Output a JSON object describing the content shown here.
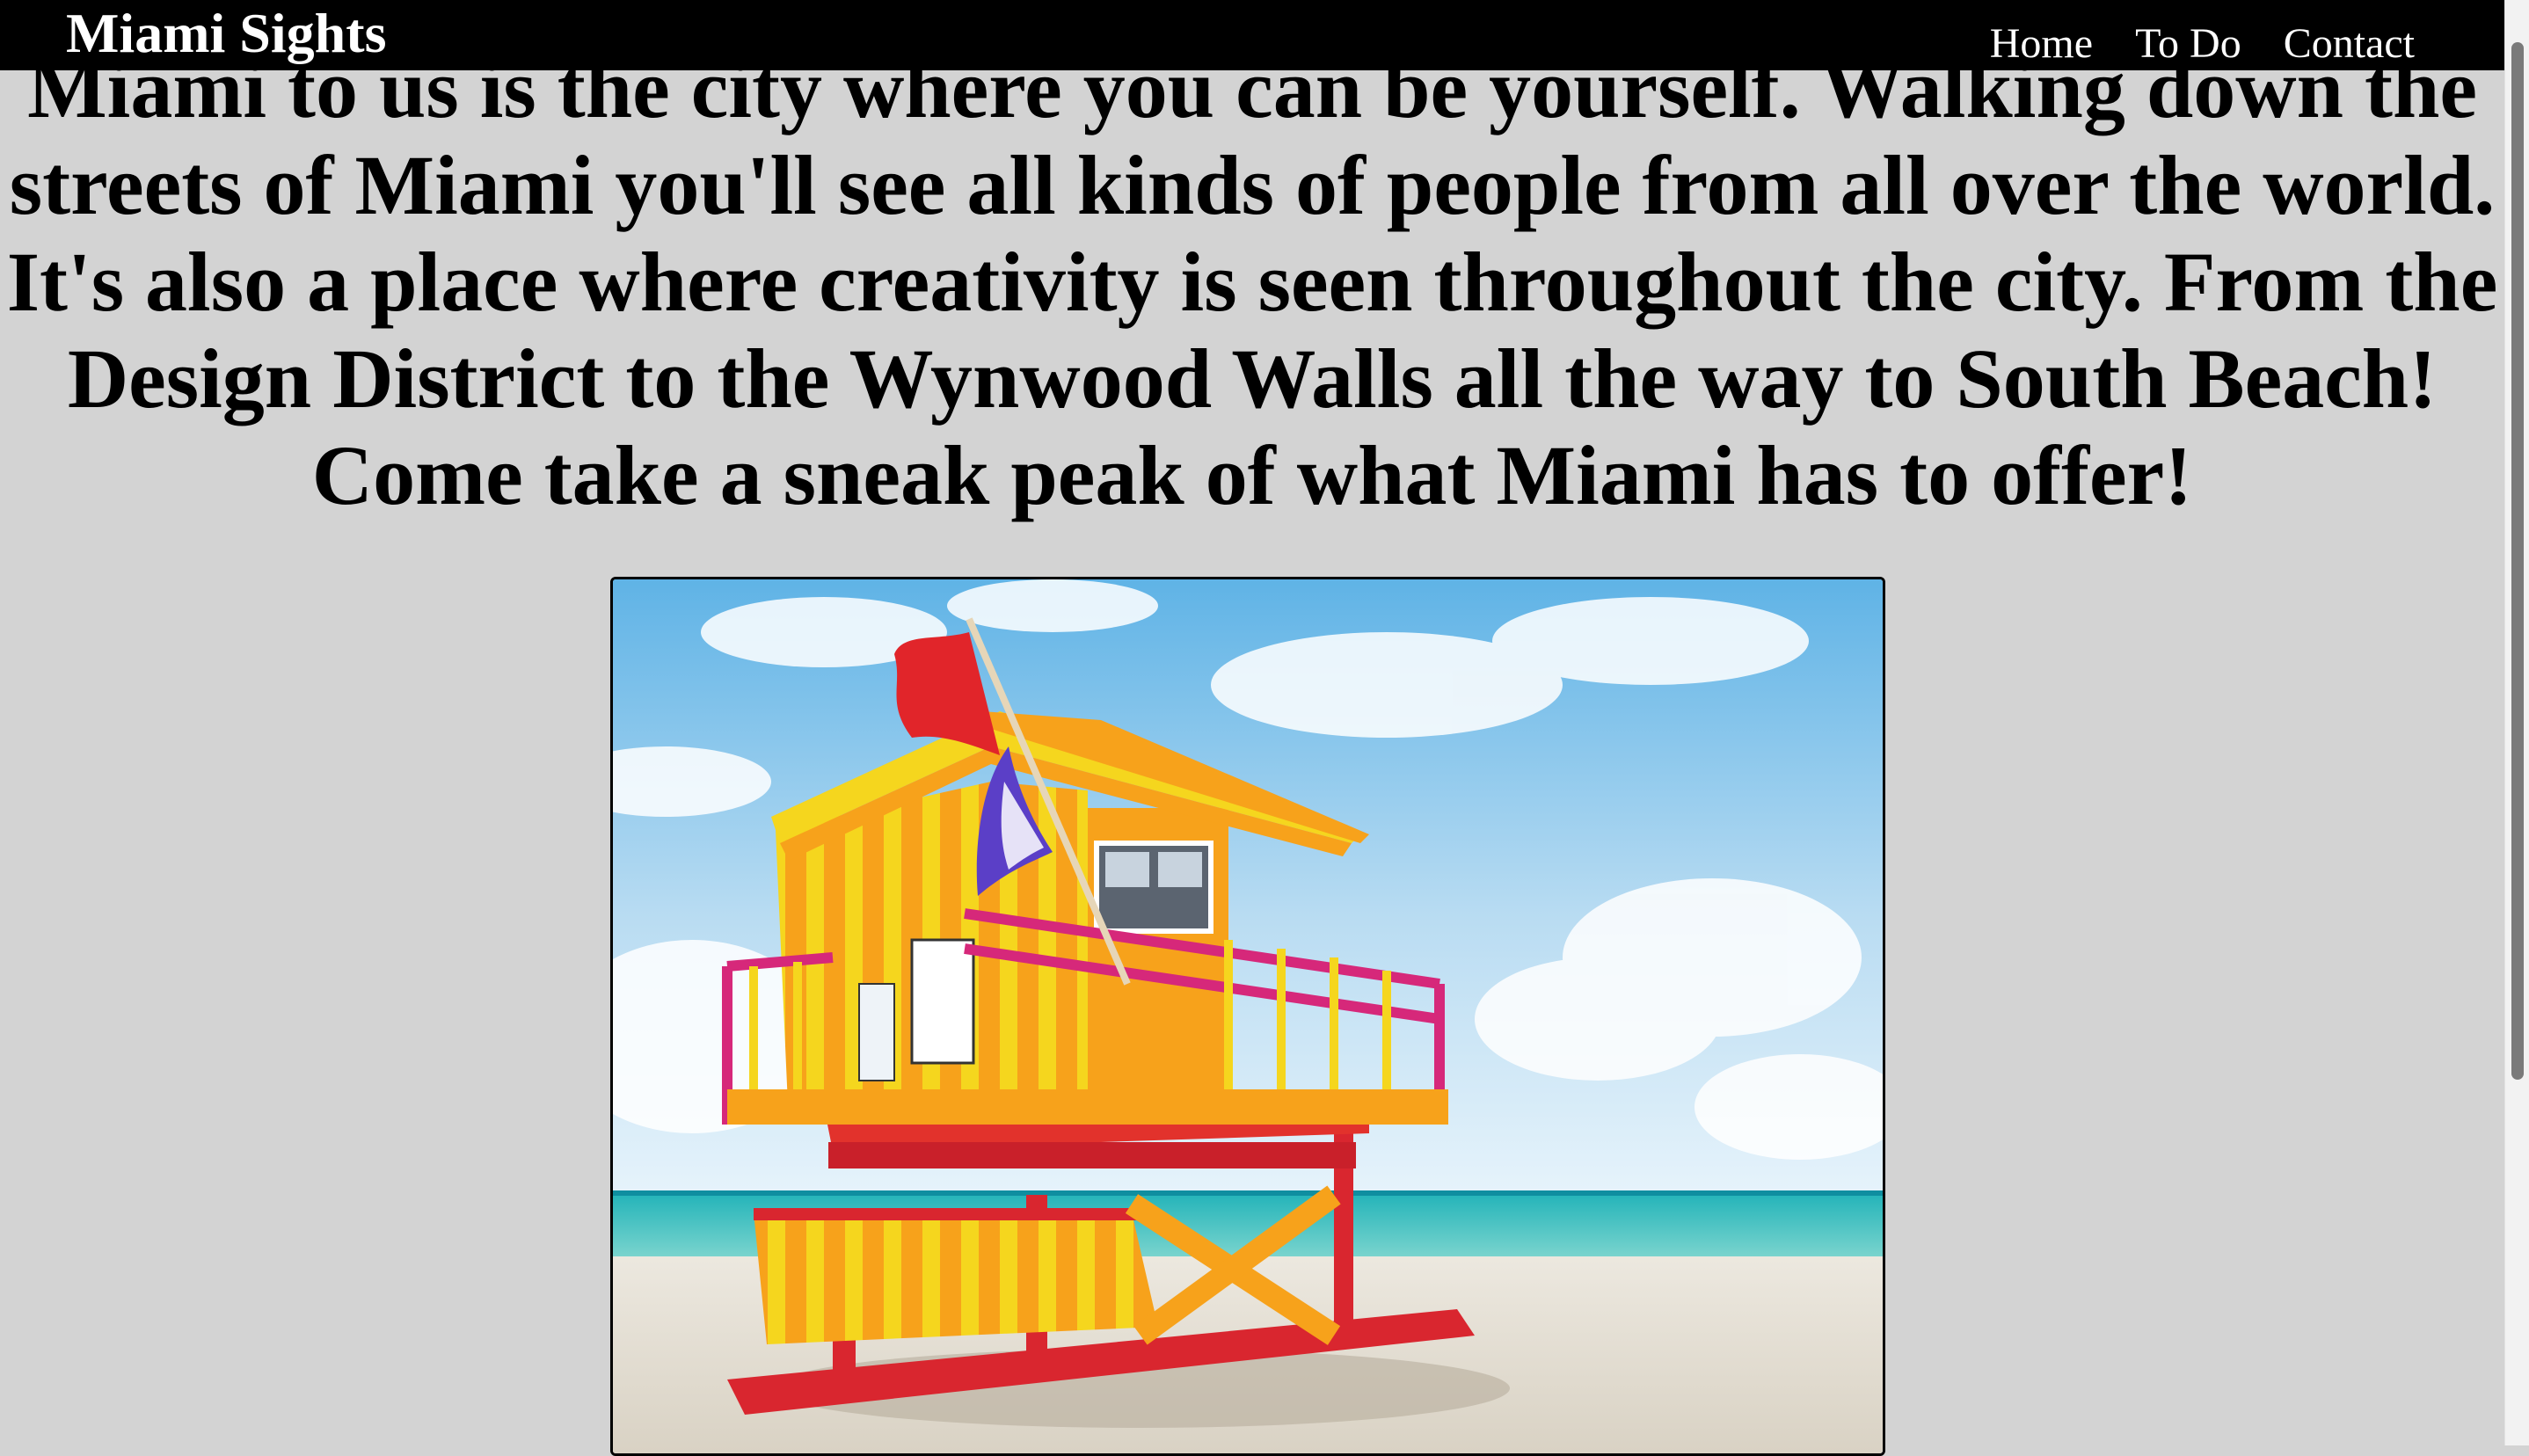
{
  "site": {
    "title": "Miami Sights"
  },
  "nav": {
    "links": [
      {
        "label": "Home"
      },
      {
        "label": "To Do"
      },
      {
        "label": "Contact"
      }
    ]
  },
  "main": {
    "headline": "Miami to us is the city where you can be yourself. Walking down the streets of Miami you'll see all kinds of people from all over the world. It's also a place where creativity is seen throughout the city. From the Design District to the Wynwood Walls all the way to South Beach! Come take a sneak peak of what Miami has to offer!"
  },
  "colors": {
    "page_background": "#d3d3d3",
    "navbar_background": "#000000",
    "navbar_text": "#ffffff",
    "headline_text": "#000000",
    "image_border": "#000000"
  },
  "icons": {
    "hero_image": "lifeguard-tower-photo"
  }
}
